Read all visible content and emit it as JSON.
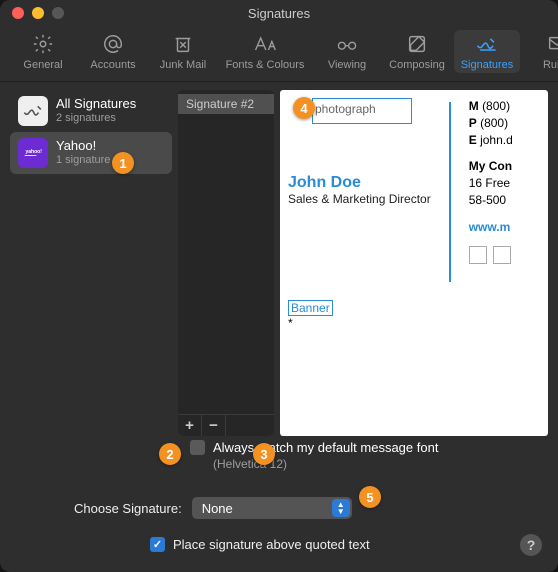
{
  "window": {
    "title": "Signatures"
  },
  "toolbar": {
    "general": "General",
    "accounts": "Accounts",
    "junk": "Junk Mail",
    "fonts": "Fonts & Colours",
    "viewing": "Viewing",
    "composing": "Composing",
    "signatures": "Signatures",
    "rules": "Rules"
  },
  "accounts_list": [
    {
      "name": "All Signatures",
      "sub": "2 signatures"
    },
    {
      "name": "Yahoo!",
      "sub": "1 signature"
    }
  ],
  "sig_list": [
    "Signature #2"
  ],
  "preview": {
    "photograph": "photograph",
    "name": "John Doe",
    "title": "Sales & Marketing Director",
    "m_label": "M",
    "m_val": "(800)",
    "p_label": "P",
    "p_val": "(800)",
    "e_label": "E",
    "e_val": "john.d",
    "company": "My Con",
    "addr1": "16 Free",
    "addr2": "58-500",
    "site": "www.m",
    "banner": "Banner",
    "star": "*"
  },
  "match": {
    "label": "Always match my default message font",
    "sub": "(Helvetica 12)"
  },
  "choose": {
    "label": "Choose Signature:",
    "value": "None"
  },
  "place": {
    "label": "Place signature above quoted text"
  },
  "callouts": {
    "c1": "1",
    "c2": "2",
    "c3": "3",
    "c4": "4",
    "c5": "5"
  }
}
